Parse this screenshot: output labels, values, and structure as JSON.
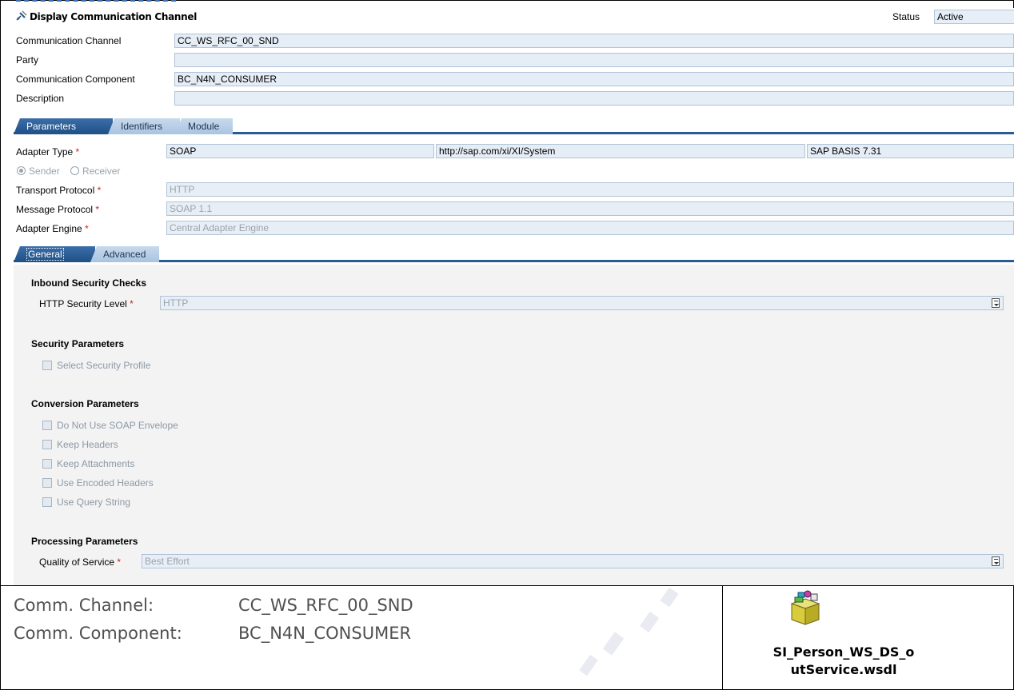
{
  "window": {
    "title": "Display Communication Channel",
    "status_label": "Status",
    "status_value": "Active"
  },
  "header_fields": [
    {
      "label": "Communication Channel",
      "value": "CC_WS_RFC_00_SND"
    },
    {
      "label": "Party",
      "value": ""
    },
    {
      "label": "Communication Component",
      "value": "BC_N4N_CONSUMER"
    },
    {
      "label": "Description",
      "value": ""
    }
  ],
  "main_tabs": [
    "Parameters",
    "Identifiers",
    "Module"
  ],
  "adapter": {
    "type_label": "Adapter Type",
    "type_value": "SOAP",
    "namespace_value": "http://sap.com/xi/XI/System",
    "swc_value": "SAP BASIS 7.31",
    "sender_label": "Sender",
    "receiver_label": "Receiver",
    "transport_label": "Transport Protocol",
    "transport_value": "HTTP",
    "message_label": "Message Protocol",
    "message_value": "SOAP 1.1",
    "engine_label": "Adapter Engine",
    "engine_value": "Central Adapter Engine"
  },
  "sub_tabs": [
    "General",
    "Advanced"
  ],
  "inbound": {
    "heading": "Inbound Security Checks",
    "level_label": "HTTP Security Level",
    "level_value": "HTTP"
  },
  "security": {
    "heading": "Security Parameters",
    "profile_label": "Select Security Profile"
  },
  "conversion": {
    "heading": "Conversion Parameters",
    "options": [
      "Do Not Use SOAP Envelope",
      "Keep Headers",
      "Keep Attachments",
      "Use Encoded Headers",
      "Use Query String"
    ]
  },
  "processing": {
    "heading": "Processing Parameters",
    "qos_label": "Quality of Service",
    "qos_value": "Best Effort"
  },
  "required_marker": "*",
  "summary": {
    "channel_label": "Comm. Channel:",
    "channel_value": "CC_WS_RFC_00_SND",
    "component_label": "Comm. Component:",
    "component_value": "BC_N4N_CONSUMER"
  },
  "attachment": {
    "filename_line1": "SI_Person_WS_DS_o",
    "filename_line2": "utService.wsdl",
    "icon": "wsdl-package-icon"
  }
}
